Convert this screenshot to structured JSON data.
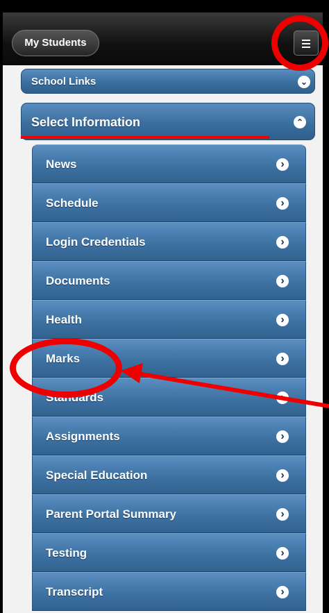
{
  "header": {
    "back_label": "My Students",
    "menu_icon": "hamburger-icon"
  },
  "school_links": {
    "label": "School Links",
    "expanded": false
  },
  "select_information": {
    "label": "Select Information",
    "expanded": true
  },
  "menu_items": [
    {
      "label": "News"
    },
    {
      "label": "Schedule"
    },
    {
      "label": "Login Credentials"
    },
    {
      "label": "Documents"
    },
    {
      "label": "Health"
    },
    {
      "label": "Marks"
    },
    {
      "label": "Standards"
    },
    {
      "label": "Assignments"
    },
    {
      "label": "Special Education"
    },
    {
      "label": "Parent Portal Summary"
    },
    {
      "label": "Testing"
    },
    {
      "label": "Transcript"
    }
  ],
  "colors": {
    "header": "#111111",
    "list_blue": "#3e72a3",
    "annotation_red": "#ee0000"
  }
}
